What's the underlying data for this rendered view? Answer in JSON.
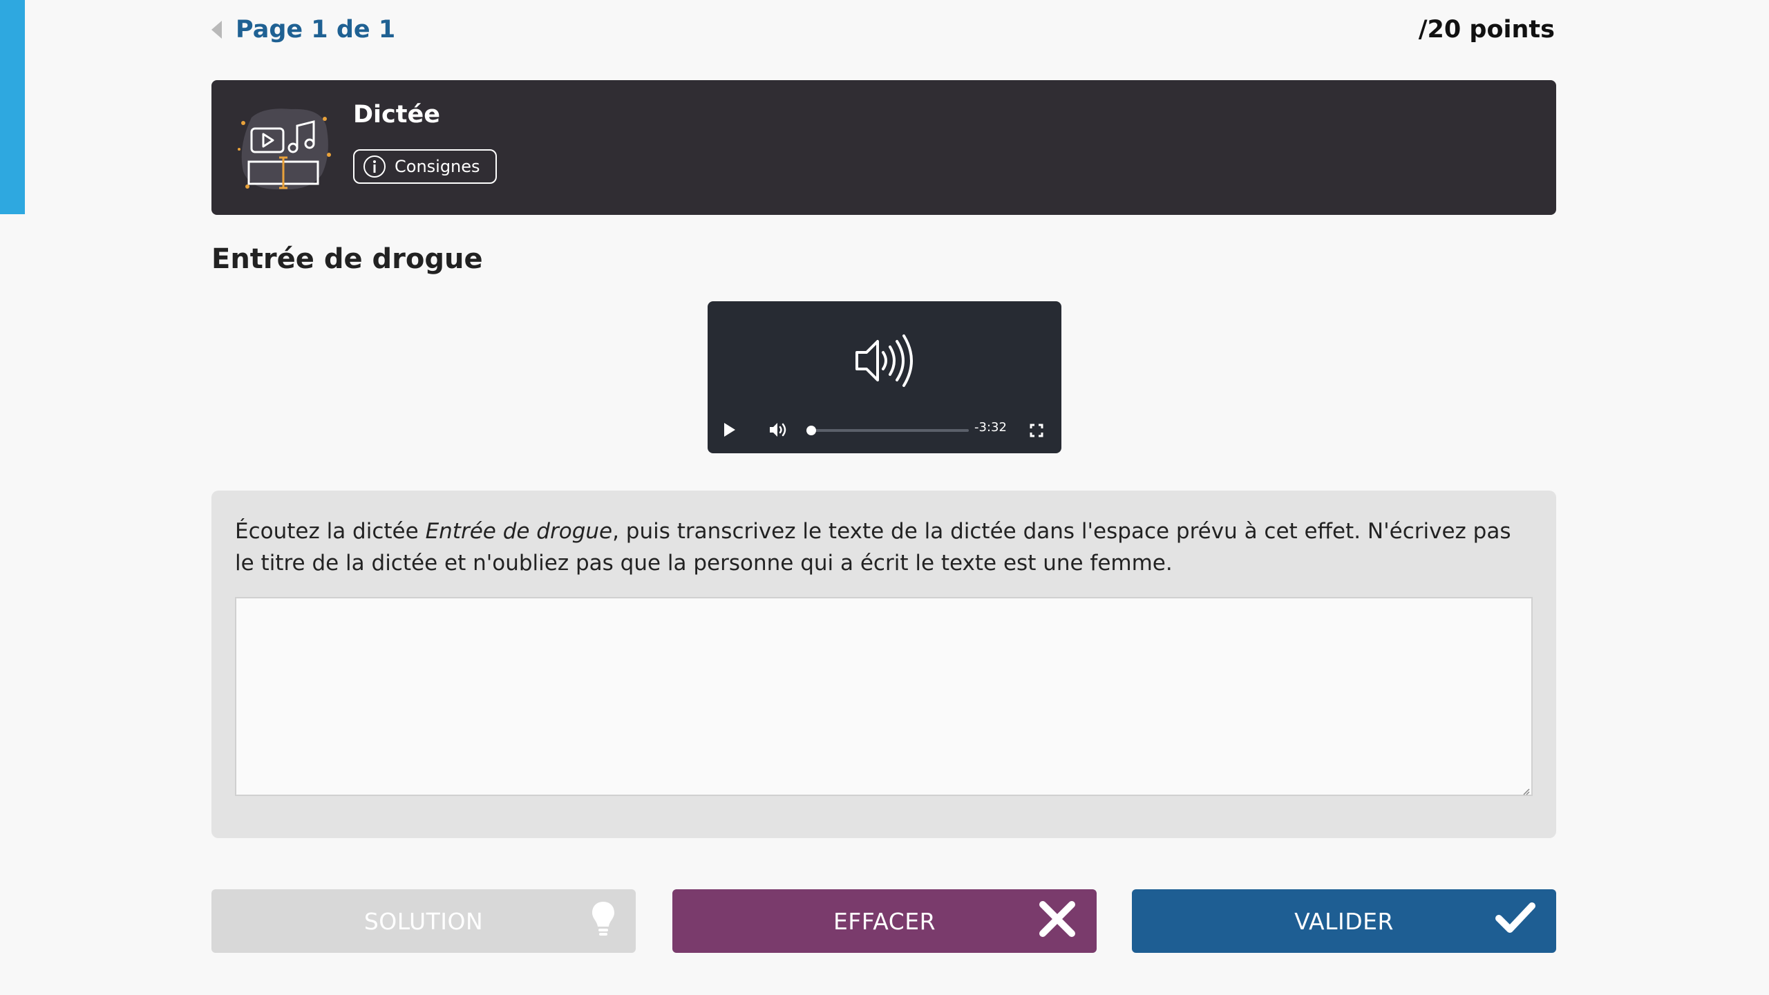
{
  "pager": {
    "label": "Page 1 de 1"
  },
  "score": {
    "label": "/20 points"
  },
  "activity": {
    "title": "Dictée",
    "consignes_label": "Consignes",
    "icon": "dictation-icon"
  },
  "exercise": {
    "title": "Entrée de drogue"
  },
  "audio": {
    "time_remaining": "-3:32",
    "progress": 0,
    "icons": [
      "speaker-icon",
      "play-icon",
      "volume-icon",
      "fullscreen-icon"
    ]
  },
  "instructions": {
    "before": "Écoutez la dictée ",
    "italic": "Entrée de drogue",
    "after": ", puis transcrivez le texte de la dictée dans l'espace prévu à cet effet. N'écrivez pas le titre de la dictée et n'oubliez pas que la personne qui a écrit le texte est une femme."
  },
  "answer": {
    "value": "",
    "placeholder": ""
  },
  "buttons": {
    "solution": "SOLUTION",
    "effacer": "EFFACER",
    "valider": "VALIDER"
  },
  "colors": {
    "accent_blue": "#2ea8e0",
    "header_bg": "#302d33",
    "effacer": "#7a3b6c",
    "valider": "#1e5e93",
    "solution_disabled": "#d8d8d8"
  }
}
